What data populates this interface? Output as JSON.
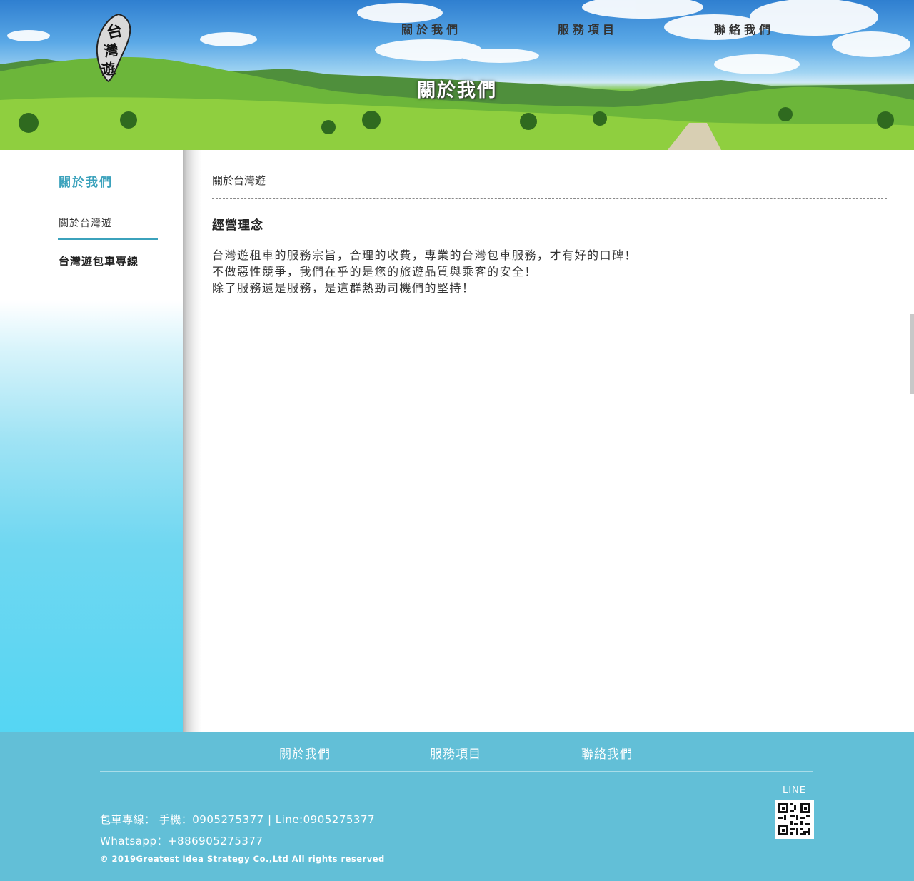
{
  "header": {
    "logo_text": "台灣遊",
    "nav": [
      {
        "label": "關於我們"
      },
      {
        "label": "服務項目"
      },
      {
        "label": "聯絡我們"
      }
    ],
    "page_title": "關於我們"
  },
  "sidebar": {
    "title": "關於我們",
    "items": [
      {
        "label": "關於台灣遊",
        "active": true
      },
      {
        "label": "台灣遊包車專線",
        "active": false
      }
    ]
  },
  "main": {
    "breadcrumb": "關於台灣遊",
    "section_title": "經營理念",
    "paragraphs": [
      "台灣遊租車的服務宗旨，合理的收費，專業的台灣包車服務，才有好的口碑！",
      "不做惡性競爭，我們在乎的是您的旅遊品質與乘客的安全！",
      "除了服務還是服務，是這群熱勁司機們的堅持！"
    ]
  },
  "footer": {
    "nav": [
      {
        "label": "關於我們"
      },
      {
        "label": "服務項目"
      },
      {
        "label": "聯絡我們"
      }
    ],
    "contact_line": "包車專線： 手機：0905275377 | Line:0905275377",
    "whatsapp_line": "Whatsapp：+886905275377",
    "copyright": "© 2019Greatest Idea Strategy Co.,Ltd All rights reserved",
    "line_label": "LINE"
  },
  "colors": {
    "accent": "#3ba2bc",
    "footer_bg": "#62bfd7"
  }
}
